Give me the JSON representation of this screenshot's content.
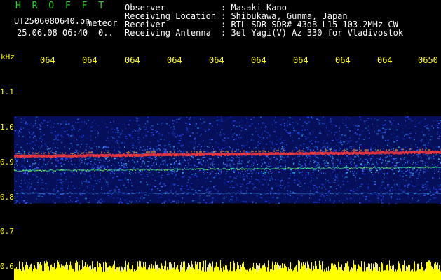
{
  "header": {
    "app_name": "H R O F F T",
    "filename": "UT2506080640.pn",
    "tag": "meteor",
    "datetime": "25.06.08 06:40",
    "count": "0.."
  },
  "info": [
    {
      "label": "Observer",
      "value": ": Masaki Kano"
    },
    {
      "label": "Receiving Location",
      "value": ": Shibukawa, Gunma, Japan"
    },
    {
      "label": "Receiver",
      "value": ": RTL-SDR SDR# 43dB L15 103.2MHz CW"
    },
    {
      "label": "Receiving Antenna",
      "value": ": 3el Yagi(V) Az 330 for Vladivostok"
    }
  ],
  "axes": {
    "y_unit": "kHz",
    "y_ticks": [
      "1.1",
      "1.0",
      "0.9",
      "0.8",
      "0.7",
      "0.6"
    ],
    "x_ticks": [
      "064",
      "064",
      "064",
      "064",
      "064",
      "064",
      "064",
      "064",
      "064",
      "0650"
    ]
  },
  "colors": {
    "text_yellow": "#ffff00",
    "title_green": "#2bd42b",
    "background": "#000000",
    "signal_red": "#ff3a3a",
    "noise_blue": "#1e3cff"
  },
  "waterfall": {
    "freq_min": 0.6,
    "freq_max": 1.14,
    "noise_band": [
      0.78,
      1.03
    ],
    "carrier_line": 0.917,
    "secondary_line": 0.875,
    "baseline_band": [
      0.805,
      0.815
    ]
  }
}
